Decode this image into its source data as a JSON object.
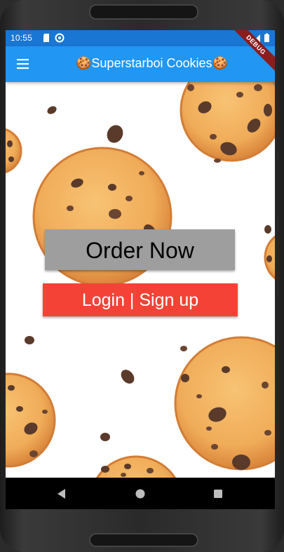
{
  "status_bar": {
    "time": "10:55"
  },
  "app_bar": {
    "title": "🍪Superstarboi Cookies🍪",
    "menu_icon": "hamburger-menu-icon"
  },
  "debug_banner": "DEBUG",
  "main": {
    "order_button_label": "Order Now",
    "login_button_label": "Login | Sign up"
  },
  "colors": {
    "status_bar": "#1976d2",
    "app_bar": "#2196f3",
    "order_button": "#9e9e9e",
    "login_button": "#f44336",
    "cookie_dough": "#f2b25e",
    "cookie_edge": "#d8863c",
    "chocolate_chip": "#5a3a2a"
  },
  "nav_bar": {
    "back_icon": "back-triangle-icon",
    "home_icon": "home-circle-icon",
    "recents_icon": "recents-square-icon"
  }
}
